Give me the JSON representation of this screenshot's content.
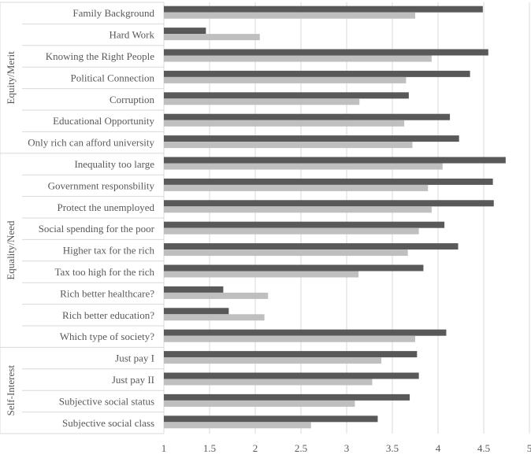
{
  "chart_data": {
    "type": "bar",
    "orientation": "horizontal",
    "title": "",
    "xlabel": "",
    "ylabel": "",
    "xlim": [
      1,
      5
    ],
    "xticks": [
      "1",
      "1.5",
      "2",
      "2.5",
      "3",
      "3.5",
      "4",
      "4.5",
      "5"
    ],
    "grid": "vertical",
    "legend": "none",
    "groups": [
      {
        "label": "Equity/Merit",
        "categories": [
          "Family Background",
          "Hard Work",
          "Knowing the Right People",
          "Political Connection",
          "Corruption",
          "Educational Opportunity",
          "Only rich can afford university"
        ]
      },
      {
        "label": "Equality/Need",
        "categories": [
          "Inequality too large",
          "Government responsbility",
          "Protect the unemployed",
          "Social spending for the poor",
          "Higher tax for the rich",
          "Tax too high for the rich",
          "Rich better healthcare?",
          "Rich better education?",
          "Which type of society?"
        ]
      },
      {
        "label": "Self-Interest",
        "categories": [
          "Just pay I",
          "Just pay II",
          "Subjective social status",
          "Subjective social class"
        ]
      }
    ],
    "series": [
      {
        "color": "#595959",
        "values": [
          4.49,
          1.46,
          4.55,
          4.35,
          3.68,
          4.13,
          4.23,
          4.74,
          4.6,
          4.61,
          4.07,
          4.22,
          3.84,
          1.65,
          1.71,
          4.09,
          3.77,
          3.79,
          3.69,
          3.34
        ]
      },
      {
        "color": "#bfbfbf",
        "values": [
          3.75,
          2.05,
          3.93,
          3.65,
          3.14,
          3.63,
          3.72,
          4.05,
          3.89,
          3.93,
          3.79,
          3.67,
          3.13,
          2.14,
          2.1,
          3.75,
          3.38,
          3.28,
          3.09,
          2.61
        ]
      }
    ]
  }
}
